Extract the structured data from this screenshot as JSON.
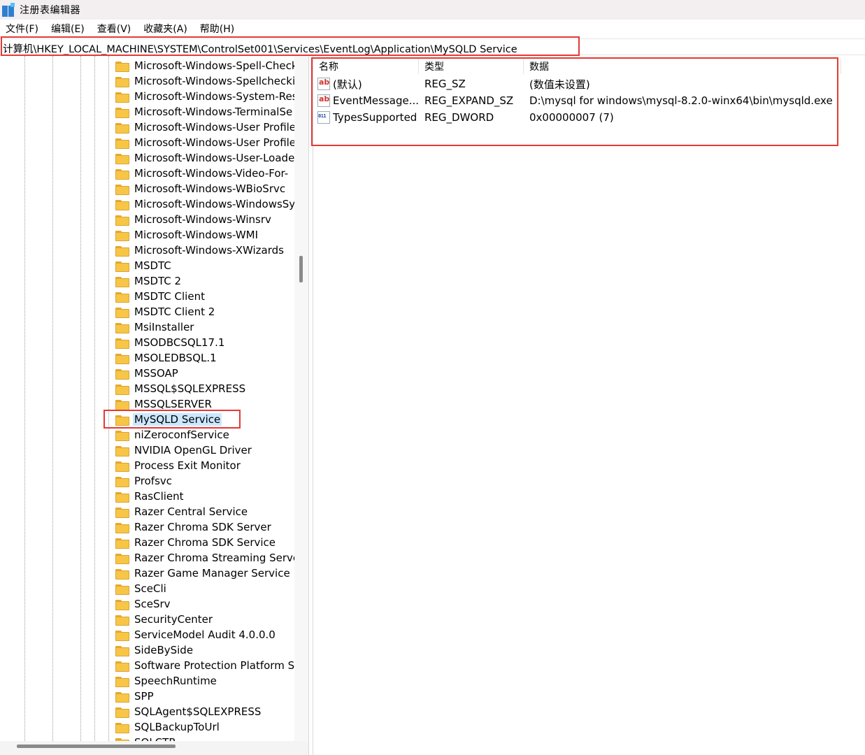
{
  "window": {
    "title": "注册表编辑器",
    "icon": "registry-editor-icon"
  },
  "menu": [
    "文件(F)",
    "编辑(E)",
    "查看(V)",
    "收藏夹(A)",
    "帮助(H)"
  ],
  "address": "计算机\\HKEY_LOCAL_MACHINE\\SYSTEM\\ControlSet001\\Services\\EventLog\\Application\\MySQLD Service",
  "tree": {
    "items": [
      "Microsoft-Windows-Spell-Check",
      "Microsoft-Windows-Spellchecki",
      "Microsoft-Windows-System-Res",
      "Microsoft-Windows-TerminalSe",
      "Microsoft-Windows-User Profile",
      "Microsoft-Windows-User Profile",
      "Microsoft-Windows-User-Loade",
      "Microsoft-Windows-Video-For-",
      "Microsoft-Windows-WBioSrvc",
      "Microsoft-Windows-WindowsSy",
      "Microsoft-Windows-Winsrv",
      "Microsoft-Windows-WMI",
      "Microsoft-Windows-XWizards",
      "MSDTC",
      "MSDTC 2",
      "MSDTC Client",
      "MSDTC Client 2",
      "MsiInstaller",
      "MSODBCSQL17.1",
      "MSOLEDBSQL.1",
      "MSSOAP",
      "MSSQL$SQLEXPRESS",
      "MSSQLSERVER",
      "MySQLD Service",
      "niZeroconfService",
      "NVIDIA OpenGL Driver",
      "Process Exit Monitor",
      "Profsvc",
      "RasClient",
      "Razer Central Service",
      "Razer Chroma SDK Server",
      "Razer Chroma SDK Service",
      "Razer Chroma Streaming Server",
      "Razer Game Manager Service",
      "SceCli",
      "SceSrv",
      "SecurityCenter",
      "ServiceModel Audit 4.0.0.0",
      "SideBySide",
      "Software Protection Platform Se",
      "SpeechRuntime",
      "SPP",
      "SQLAgent$SQLEXPRESS",
      "SQLBackupToUrl",
      "SQLCTR"
    ],
    "selected": "MySQLD Service"
  },
  "list": {
    "headers": {
      "name": "名称",
      "type": "类型",
      "data": "数据"
    },
    "rows": [
      {
        "icon": "string-value-icon",
        "name": "(默认)",
        "type": "REG_SZ",
        "data": "(数值未设置)"
      },
      {
        "icon": "string-value-icon",
        "name": "EventMessage...",
        "type": "REG_EXPAND_SZ",
        "data": "D:\\mysql for windows\\mysql-8.2.0-winx64\\bin\\mysqld.exe"
      },
      {
        "icon": "binary-value-icon",
        "name": "TypesSupported",
        "type": "REG_DWORD",
        "data": "0x00000007 (7)"
      }
    ]
  },
  "colors": {
    "highlight": "#e53935",
    "selection": "#cce8ff",
    "folder": "#f8c646"
  }
}
